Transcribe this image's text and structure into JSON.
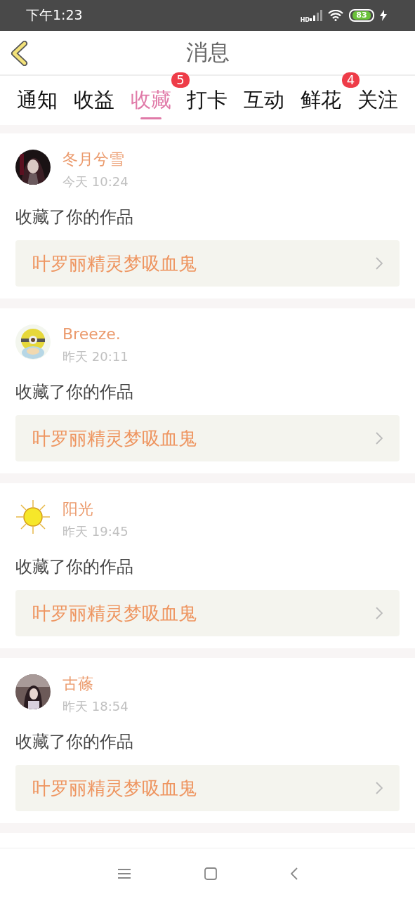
{
  "status_bar": {
    "time": "下午1:23",
    "network": "HD",
    "battery": "83"
  },
  "header": {
    "title": "消息"
  },
  "tabs": [
    {
      "label": "通知",
      "selected": false
    },
    {
      "label": "收益",
      "selected": false
    },
    {
      "label": "收藏",
      "selected": true,
      "badge": "5"
    },
    {
      "label": "打卡",
      "selected": false
    },
    {
      "label": "互动",
      "selected": false
    },
    {
      "label": "鲜花",
      "selected": false,
      "badge": "4"
    },
    {
      "label": "关注",
      "selected": false
    }
  ],
  "messages": [
    {
      "name": "冬月兮雪",
      "time": "今天 10:24",
      "action": "收藏了你的作品",
      "work": "叶罗丽精灵梦吸血鬼"
    },
    {
      "name": "Breeze.",
      "time": "昨天 20:11",
      "action": "收藏了你的作品",
      "work": "叶罗丽精灵梦吸血鬼"
    },
    {
      "name": "阳光",
      "time": "昨天 19:45",
      "action": "收藏了你的作品",
      "work": "叶罗丽精灵梦吸血鬼"
    },
    {
      "name": "古蓧",
      "time": "昨天 18:54",
      "action": "收藏了你的作品",
      "work": "叶罗丽精灵梦吸血鬼"
    }
  ]
}
